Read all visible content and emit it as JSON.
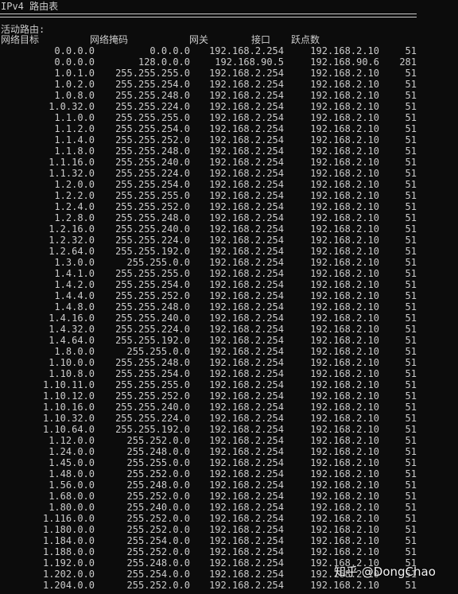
{
  "title": "IPv4 路由表",
  "section_title": "活动路由:",
  "columns": {
    "dest": "网络目标",
    "mask": "网络掩码",
    "gateway": "网关",
    "interface": "接口",
    "metric": "跃点数"
  },
  "routes": [
    {
      "dest": "0.0.0.0",
      "mask": "0.0.0.0",
      "gateway": "192.168.2.254",
      "interface": "192.168.2.10",
      "metric": "51"
    },
    {
      "dest": "0.0.0.0",
      "mask": "128.0.0.0",
      "gateway": "192.168.90.5",
      "interface": "192.168.90.6",
      "metric": "281"
    },
    {
      "dest": "1.0.1.0",
      "mask": "255.255.255.0",
      "gateway": "192.168.2.254",
      "interface": "192.168.2.10",
      "metric": "51"
    },
    {
      "dest": "1.0.2.0",
      "mask": "255.255.254.0",
      "gateway": "192.168.2.254",
      "interface": "192.168.2.10",
      "metric": "51"
    },
    {
      "dest": "1.0.8.0",
      "mask": "255.255.248.0",
      "gateway": "192.168.2.254",
      "interface": "192.168.2.10",
      "metric": "51"
    },
    {
      "dest": "1.0.32.0",
      "mask": "255.255.224.0",
      "gateway": "192.168.2.254",
      "interface": "192.168.2.10",
      "metric": "51"
    },
    {
      "dest": "1.1.0.0",
      "mask": "255.255.255.0",
      "gateway": "192.168.2.254",
      "interface": "192.168.2.10",
      "metric": "51"
    },
    {
      "dest": "1.1.2.0",
      "mask": "255.255.254.0",
      "gateway": "192.168.2.254",
      "interface": "192.168.2.10",
      "metric": "51"
    },
    {
      "dest": "1.1.4.0",
      "mask": "255.255.252.0",
      "gateway": "192.168.2.254",
      "interface": "192.168.2.10",
      "metric": "51"
    },
    {
      "dest": "1.1.8.0",
      "mask": "255.255.248.0",
      "gateway": "192.168.2.254",
      "interface": "192.168.2.10",
      "metric": "51"
    },
    {
      "dest": "1.1.16.0",
      "mask": "255.255.240.0",
      "gateway": "192.168.2.254",
      "interface": "192.168.2.10",
      "metric": "51"
    },
    {
      "dest": "1.1.32.0",
      "mask": "255.255.224.0",
      "gateway": "192.168.2.254",
      "interface": "192.168.2.10",
      "metric": "51"
    },
    {
      "dest": "1.2.0.0",
      "mask": "255.255.254.0",
      "gateway": "192.168.2.254",
      "interface": "192.168.2.10",
      "metric": "51"
    },
    {
      "dest": "1.2.2.0",
      "mask": "255.255.255.0",
      "gateway": "192.168.2.254",
      "interface": "192.168.2.10",
      "metric": "51"
    },
    {
      "dest": "1.2.4.0",
      "mask": "255.255.252.0",
      "gateway": "192.168.2.254",
      "interface": "192.168.2.10",
      "metric": "51"
    },
    {
      "dest": "1.2.8.0",
      "mask": "255.255.248.0",
      "gateway": "192.168.2.254",
      "interface": "192.168.2.10",
      "metric": "51"
    },
    {
      "dest": "1.2.16.0",
      "mask": "255.255.240.0",
      "gateway": "192.168.2.254",
      "interface": "192.168.2.10",
      "metric": "51"
    },
    {
      "dest": "1.2.32.0",
      "mask": "255.255.224.0",
      "gateway": "192.168.2.254",
      "interface": "192.168.2.10",
      "metric": "51"
    },
    {
      "dest": "1.2.64.0",
      "mask": "255.255.192.0",
      "gateway": "192.168.2.254",
      "interface": "192.168.2.10",
      "metric": "51"
    },
    {
      "dest": "1.3.0.0",
      "mask": "255.255.0.0",
      "gateway": "192.168.2.254",
      "interface": "192.168.2.10",
      "metric": "51"
    },
    {
      "dest": "1.4.1.0",
      "mask": "255.255.255.0",
      "gateway": "192.168.2.254",
      "interface": "192.168.2.10",
      "metric": "51"
    },
    {
      "dest": "1.4.2.0",
      "mask": "255.255.254.0",
      "gateway": "192.168.2.254",
      "interface": "192.168.2.10",
      "metric": "51"
    },
    {
      "dest": "1.4.4.0",
      "mask": "255.255.252.0",
      "gateway": "192.168.2.254",
      "interface": "192.168.2.10",
      "metric": "51"
    },
    {
      "dest": "1.4.8.0",
      "mask": "255.255.248.0",
      "gateway": "192.168.2.254",
      "interface": "192.168.2.10",
      "metric": "51"
    },
    {
      "dest": "1.4.16.0",
      "mask": "255.255.240.0",
      "gateway": "192.168.2.254",
      "interface": "192.168.2.10",
      "metric": "51"
    },
    {
      "dest": "1.4.32.0",
      "mask": "255.255.224.0",
      "gateway": "192.168.2.254",
      "interface": "192.168.2.10",
      "metric": "51"
    },
    {
      "dest": "1.4.64.0",
      "mask": "255.255.192.0",
      "gateway": "192.168.2.254",
      "interface": "192.168.2.10",
      "metric": "51"
    },
    {
      "dest": "1.8.0.0",
      "mask": "255.255.0.0",
      "gateway": "192.168.2.254",
      "interface": "192.168.2.10",
      "metric": "51"
    },
    {
      "dest": "1.10.0.0",
      "mask": "255.255.248.0",
      "gateway": "192.168.2.254",
      "interface": "192.168.2.10",
      "metric": "51"
    },
    {
      "dest": "1.10.8.0",
      "mask": "255.255.254.0",
      "gateway": "192.168.2.254",
      "interface": "192.168.2.10",
      "metric": "51"
    },
    {
      "dest": "1.10.11.0",
      "mask": "255.255.255.0",
      "gateway": "192.168.2.254",
      "interface": "192.168.2.10",
      "metric": "51"
    },
    {
      "dest": "1.10.12.0",
      "mask": "255.255.252.0",
      "gateway": "192.168.2.254",
      "interface": "192.168.2.10",
      "metric": "51"
    },
    {
      "dest": "1.10.16.0",
      "mask": "255.255.240.0",
      "gateway": "192.168.2.254",
      "interface": "192.168.2.10",
      "metric": "51"
    },
    {
      "dest": "1.10.32.0",
      "mask": "255.255.224.0",
      "gateway": "192.168.2.254",
      "interface": "192.168.2.10",
      "metric": "51"
    },
    {
      "dest": "1.10.64.0",
      "mask": "255.255.192.0",
      "gateway": "192.168.2.254",
      "interface": "192.168.2.10",
      "metric": "51"
    },
    {
      "dest": "1.12.0.0",
      "mask": "255.252.0.0",
      "gateway": "192.168.2.254",
      "interface": "192.168.2.10",
      "metric": "51"
    },
    {
      "dest": "1.24.0.0",
      "mask": "255.248.0.0",
      "gateway": "192.168.2.254",
      "interface": "192.168.2.10",
      "metric": "51"
    },
    {
      "dest": "1.45.0.0",
      "mask": "255.255.0.0",
      "gateway": "192.168.2.254",
      "interface": "192.168.2.10",
      "metric": "51"
    },
    {
      "dest": "1.48.0.0",
      "mask": "255.252.0.0",
      "gateway": "192.168.2.254",
      "interface": "192.168.2.10",
      "metric": "51"
    },
    {
      "dest": "1.56.0.0",
      "mask": "255.248.0.0",
      "gateway": "192.168.2.254",
      "interface": "192.168.2.10",
      "metric": "51"
    },
    {
      "dest": "1.68.0.0",
      "mask": "255.252.0.0",
      "gateway": "192.168.2.254",
      "interface": "192.168.2.10",
      "metric": "51"
    },
    {
      "dest": "1.80.0.0",
      "mask": "255.240.0.0",
      "gateway": "192.168.2.254",
      "interface": "192.168.2.10",
      "metric": "51"
    },
    {
      "dest": "1.116.0.0",
      "mask": "255.252.0.0",
      "gateway": "192.168.2.254",
      "interface": "192.168.2.10",
      "metric": "51"
    },
    {
      "dest": "1.180.0.0",
      "mask": "255.252.0.0",
      "gateway": "192.168.2.254",
      "interface": "192.168.2.10",
      "metric": "51"
    },
    {
      "dest": "1.184.0.0",
      "mask": "255.254.0.0",
      "gateway": "192.168.2.254",
      "interface": "192.168.2.10",
      "metric": "51"
    },
    {
      "dest": "1.188.0.0",
      "mask": "255.252.0.0",
      "gateway": "192.168.2.254",
      "interface": "192.168.2.10",
      "metric": "51"
    },
    {
      "dest": "1.192.0.0",
      "mask": "255.248.0.0",
      "gateway": "192.168.2.254",
      "interface": "192.168.2.10",
      "metric": "51"
    },
    {
      "dest": "1.202.0.0",
      "mask": "255.254.0.0",
      "gateway": "192.168.2.254",
      "interface": "192.168.2.10",
      "metric": "51"
    },
    {
      "dest": "1.204.0.0",
      "mask": "255.252.0.0",
      "gateway": "192.168.2.254",
      "interface": "192.168.2.10",
      "metric": "51"
    }
  ],
  "watermark": "知乎 @DongChao",
  "colors": {
    "background": "#0c0c0c",
    "text": "#cccccc"
  }
}
